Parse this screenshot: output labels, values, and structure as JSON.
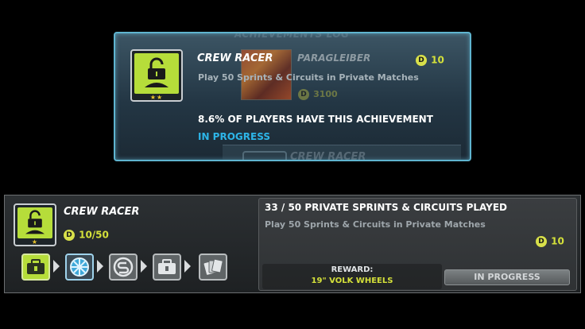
{
  "top_card": {
    "ghost_header": "ACHIEVEMENTS LOG",
    "title": "CREW RACER",
    "description": "Play 50 Sprints & Circuits in Private Matches",
    "reward_points": "10",
    "overlay_title": "PARAGLEIBER",
    "overlay_points": "3100",
    "percent_text": "8.6% OF PLAYERS HAVE THIS ACHIEVEMENT",
    "status": "IN PROGRESS",
    "ghost_next_title": "CREW RACER",
    "coin_glyph": "D",
    "stars": "★★"
  },
  "bottom_card": {
    "title": "CREW RACER",
    "progress_points": "10/50",
    "coin_glyph": "D",
    "star": "★",
    "progress_heading": "33 / 50 PRIVATE SPRINTS & CIRCUITS PLAYED",
    "description": "Play 50 Sprints & Circuits in Private Matches",
    "points": "10",
    "reward_label": "REWARD:",
    "reward_value": "19\" VOLK WHEELS",
    "status_button": "IN PROGRESS"
  },
  "steps": [
    {
      "icon": "toolbox-icon",
      "state": "completed"
    },
    {
      "icon": "wheel-icon",
      "state": "current"
    },
    {
      "icon": "currency-icon",
      "state": "locked"
    },
    {
      "icon": "toolbox-icon",
      "state": "locked"
    },
    {
      "icon": "cards-icon",
      "state": "locked"
    }
  ],
  "colors": {
    "accent_green": "#b6dd3a",
    "accent_cyan": "#2db5e8",
    "reward_yellow": "#d4e03a"
  }
}
